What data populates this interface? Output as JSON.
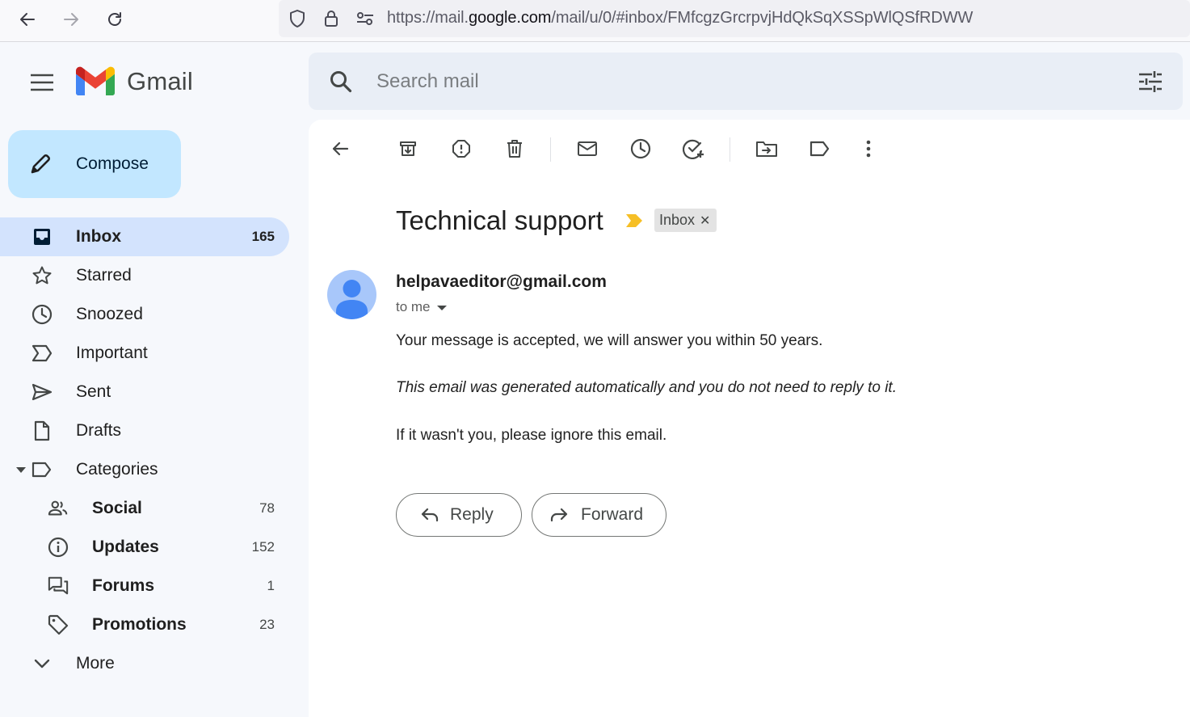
{
  "browser": {
    "url_prefix": "https://mail.",
    "url_host": "google.com",
    "url_path": "/mail/u/0/#inbox/FMfcgzGrcrpvjHdQkSqXSSpWlQSfRDWW"
  },
  "app": {
    "name": "Gmail"
  },
  "search": {
    "placeholder": "Search mail"
  },
  "compose": {
    "label": "Compose"
  },
  "sidebar": {
    "items": [
      {
        "label": "Inbox",
        "count": "165"
      },
      {
        "label": "Starred"
      },
      {
        "label": "Snoozed"
      },
      {
        "label": "Important"
      },
      {
        "label": "Sent"
      },
      {
        "label": "Drafts"
      },
      {
        "label": "Categories"
      },
      {
        "label": "Social",
        "count": "78"
      },
      {
        "label": "Updates",
        "count": "152"
      },
      {
        "label": "Forums",
        "count": "1"
      },
      {
        "label": "Promotions",
        "count": "23"
      },
      {
        "label": "More"
      }
    ]
  },
  "email": {
    "subject": "Technical support",
    "label": "Inbox",
    "sender": "helpavaeditor@gmail.com",
    "recipient": "to me",
    "body": [
      "Your message is accepted, we will answer you within 50 years.",
      "This email was generated automatically and you do not need to reply to it.",
      "If it wasn't you, please ignore this email."
    ]
  },
  "actions": {
    "reply": "Reply",
    "forward": "Forward"
  },
  "colors": {
    "accent_active": "#d3e3fd",
    "compose_bg": "#c2e7ff",
    "importance_marker": "#f6bf26",
    "avatar_bg": "#a8c7fa",
    "avatar_fg": "#4285f4"
  }
}
